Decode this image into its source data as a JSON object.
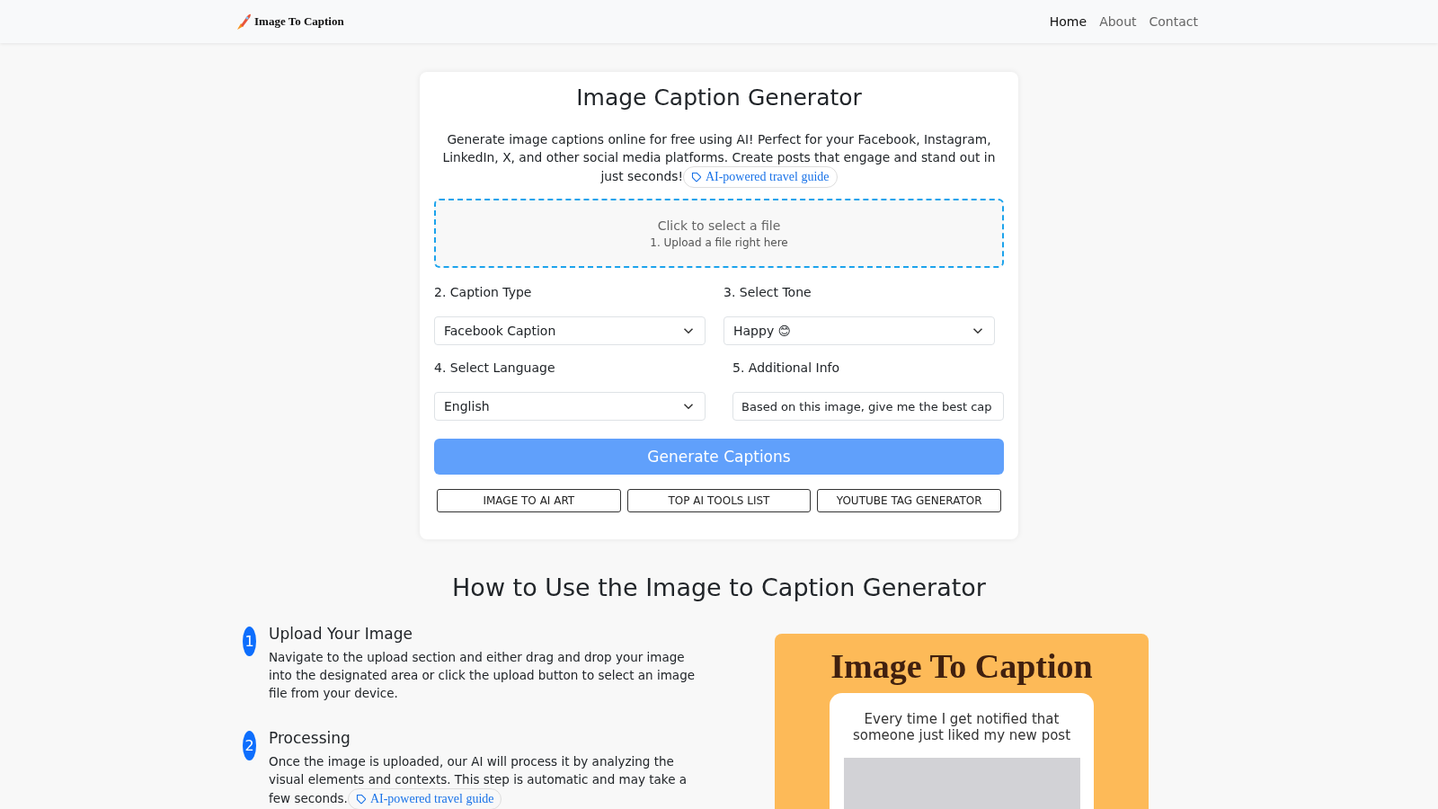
{
  "nav": {
    "brand": "Image To Caption",
    "links": [
      {
        "label": "Home",
        "selected": true
      },
      {
        "label": "About",
        "selected": false
      },
      {
        "label": "Contact",
        "selected": false
      }
    ]
  },
  "generator": {
    "title": "Image Caption Generator",
    "intro": "Generate image captions online for free using AI! Perfect for your Facebook, Instagram, LinkedIn, X, and other social media platforms. Create posts that engage and stand out in just seconds!",
    "intro_tag": "AI-powered travel guide",
    "upload": {
      "title": "Click to select a file",
      "hint": "1. Upload a file right here"
    },
    "fields": [
      {
        "kind": "select",
        "label": "2. Caption Type",
        "value": "Facebook Caption"
      },
      {
        "kind": "select",
        "label": "3. Select Tone",
        "value": "Happy 😊"
      },
      {
        "kind": "select",
        "label": "4. Select Language",
        "value": "English"
      },
      {
        "kind": "text",
        "label": "5. Additional Info",
        "value": "Based on this image, give me the best cap"
      }
    ],
    "generate_button": "Generate Captions",
    "links": [
      "IMAGE TO AI ART",
      "TOP AI TOOLS LIST",
      "YOUTUBE TAG GENERATOR"
    ]
  },
  "how_to": {
    "title": "How to Use the Image to Caption Generator",
    "steps": [
      {
        "number": "1",
        "title": "Upload Your Image",
        "text": "Navigate to the upload section and either drag and drop your image into the designated area or click the upload button to select an image file from your device."
      },
      {
        "number": "2",
        "title": "Processing",
        "text": "Once the image is uploaded, our AI will process it by analyzing the visual elements and contexts. This step is automatic and may take a few seconds.",
        "tag": "AI-powered travel guide"
      }
    ],
    "illustration": {
      "title": "Image To Caption",
      "caption": "Every time I get notified that someone just liked my new post"
    }
  }
}
